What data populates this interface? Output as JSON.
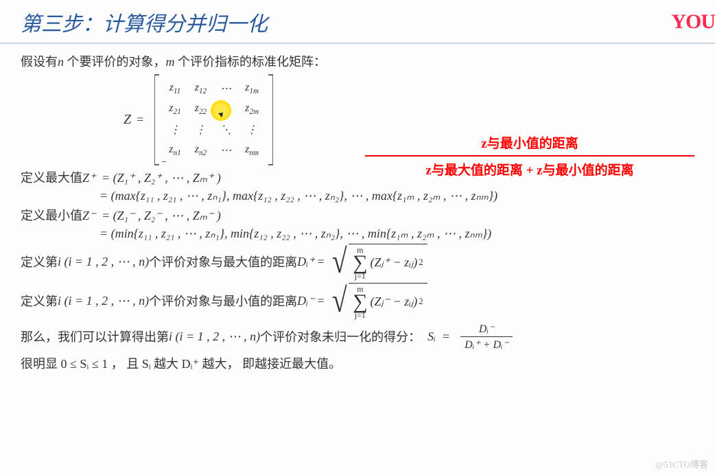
{
  "title": "第三步：计算得分并归一化",
  "logo": "YOU",
  "intro_prefix": "假设有",
  "intro_mid1": "个要评价的对象，",
  "intro_mid2": "个评价指标的标准化矩阵：",
  "var_n": "n",
  "var_m": "m",
  "Z": "Z",
  "eq": "=",
  "matrix": {
    "r1c1": "z",
    "r1c1s": "11",
    "r1c2": "z",
    "r1c2s": "12",
    "r1c3": "⋯",
    "r1c4": "z",
    "r1c4s": "1m",
    "r2c1": "z",
    "r2c1s": "21",
    "r2c2": "z",
    "r2c2s": "22",
    "r2c3": "⋯",
    "r2c4": "z",
    "r2c4s": "2m",
    "r3c1": "⋮",
    "r3c2": "⋮",
    "r3c3": "⋱",
    "r3c4": "⋮",
    "r4c1": "z",
    "r4c1s": "n1",
    "r4c2": "z",
    "r4c2s": "n2",
    "r4c3": "⋯",
    "r4c4": "z",
    "r4c4s": "nm"
  },
  "red": {
    "num": "z与最小值的距离",
    "den": "z与最大值的距离 + z与最小值的距离"
  },
  "defmax_label": "定义最大值",
  "defmin_label": "定义最小值",
  "Zplus": "Z⁺",
  "Zminus": "Z⁻",
  "tuple_plus": "= (Z₁⁺ , Z₂⁺ , ⋯ , Zₘ⁺ )",
  "tuple_minus": "= (Z₁⁻ , Z₂⁻ , ⋯ , Zₘ⁻ )",
  "expand_max": "= (max{z₁₁ , z₂₁ , ⋯ , zₙ₁}, max{z₁₂ , z₂₂ , ⋯ , zₙ₂}, ⋯ , max{z₁ₘ , z₂ₘ , ⋯ , zₙₘ})",
  "expand_min": "= (min{z₁₁ , z₂₁ , ⋯ , zₙ₁}, min{z₁₂ , z₂₂ , ⋯ , zₙ₂}, ⋯ , min{z₁ₘ , z₂ₘ , ⋯ , zₙₘ})",
  "def_i_prefix": "定义第",
  "def_i_paren": "i (i = 1 , 2 , ⋯ , n)",
  "def_i_obj_max": "个评价对象与最大值的距离",
  "def_i_obj_min": "个评价对象与最小值的距离",
  "Dplus": "Dᵢ⁺",
  "Dminus": "Dᵢ⁻",
  "sum_top": "m",
  "sum_bot": "j=1",
  "term_plus": "(Zⱼ⁺ − zᵢⱼ)",
  "term_minus": "(Zⱼ⁻ − zᵢⱼ)",
  "sq": "2",
  "then": "那么，我们可以计算得出第",
  "then_i": "i (i = 1 , 2 , ⋯ , n)",
  "then_tail": "个评价对象未归一化的得分：",
  "Si": "Sᵢ",
  "frac_num": "Dᵢ⁻",
  "frac_den": "Dᵢ⁺ + Dᵢ⁻",
  "obvious": "很明显 0 ≤ Sᵢ ≤ 1 ，  且 Sᵢ 越大 Dᵢ⁺ 越大，  即越接近最大值。",
  "watermark": "@51CTO博客"
}
